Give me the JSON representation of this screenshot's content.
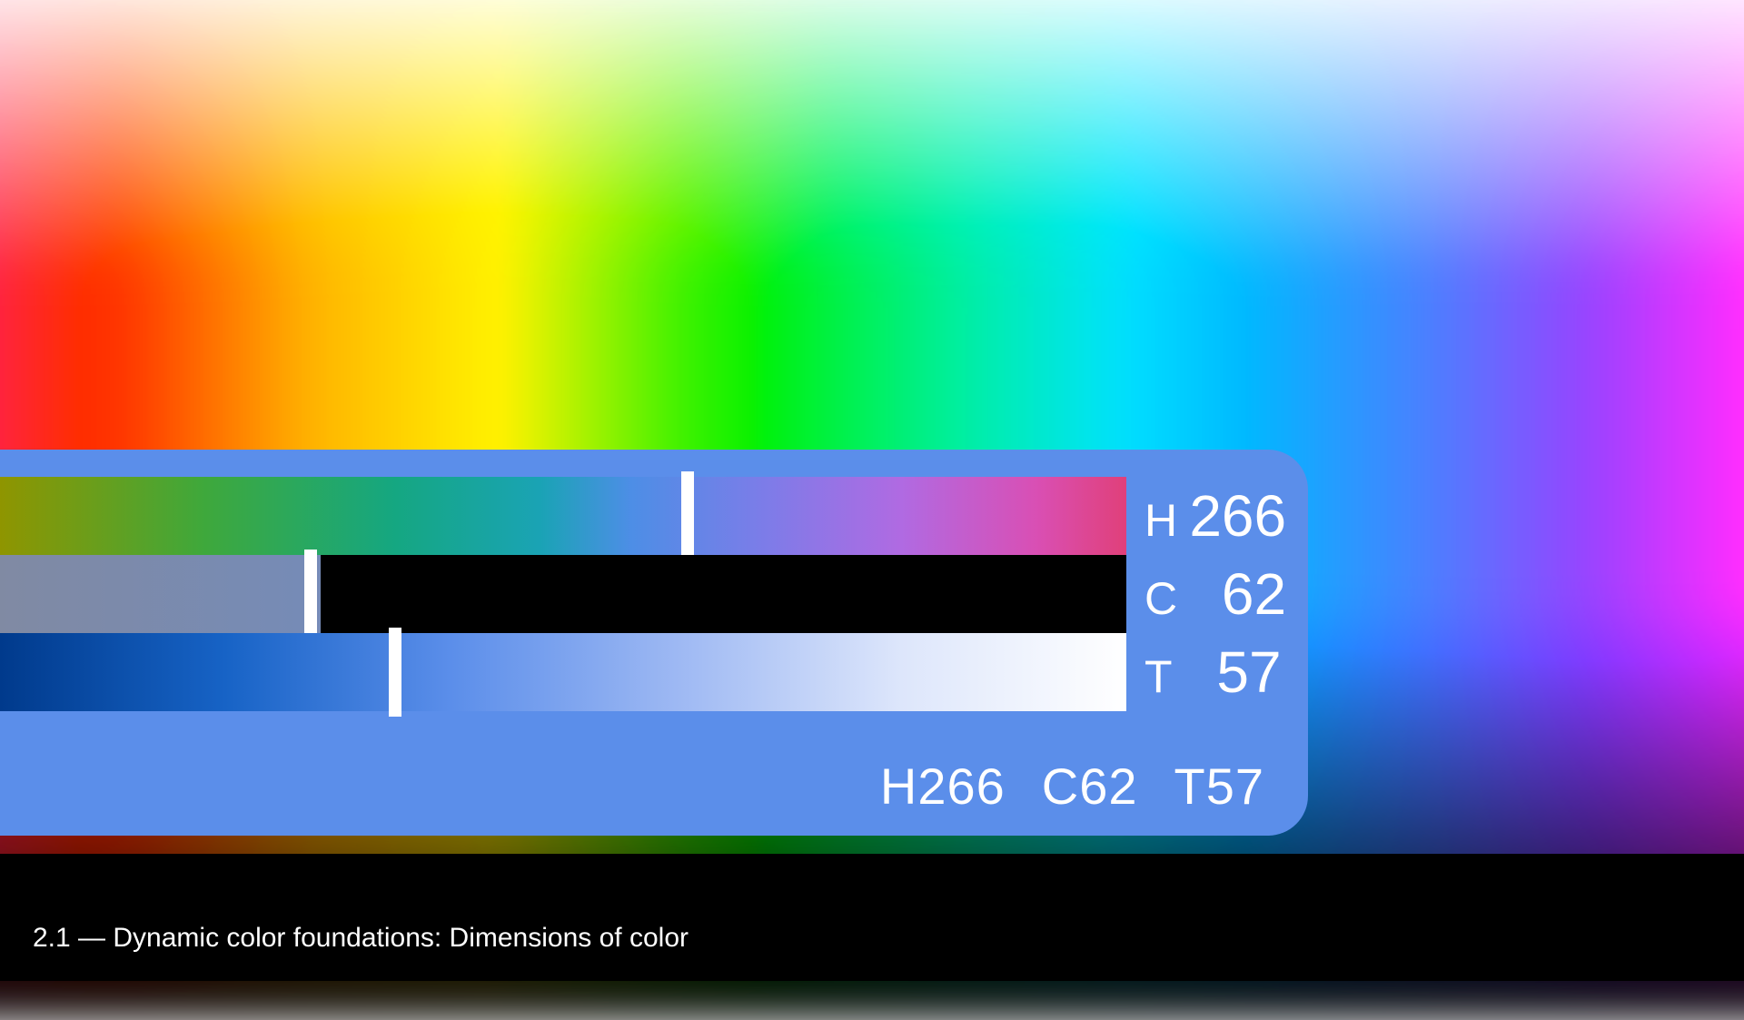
{
  "panel_bg": "#5b8eea",
  "sliders": {
    "hue": {
      "label": "H",
      "value": 266,
      "max": 360,
      "thumb_pct": 60.5
    },
    "chroma": {
      "label": "C",
      "value": 62,
      "max": 150,
      "thumb_pct": 27.0,
      "gamut_end_pct": 28.5
    },
    "tone": {
      "label": "T",
      "value": 57,
      "max": 100,
      "thumb_pct": 34.5
    }
  },
  "summary": {
    "h": "H266",
    "c": "C62",
    "t": "T57"
  },
  "caption": "2.1 — Dynamic color foundations: Dimensions of color"
}
